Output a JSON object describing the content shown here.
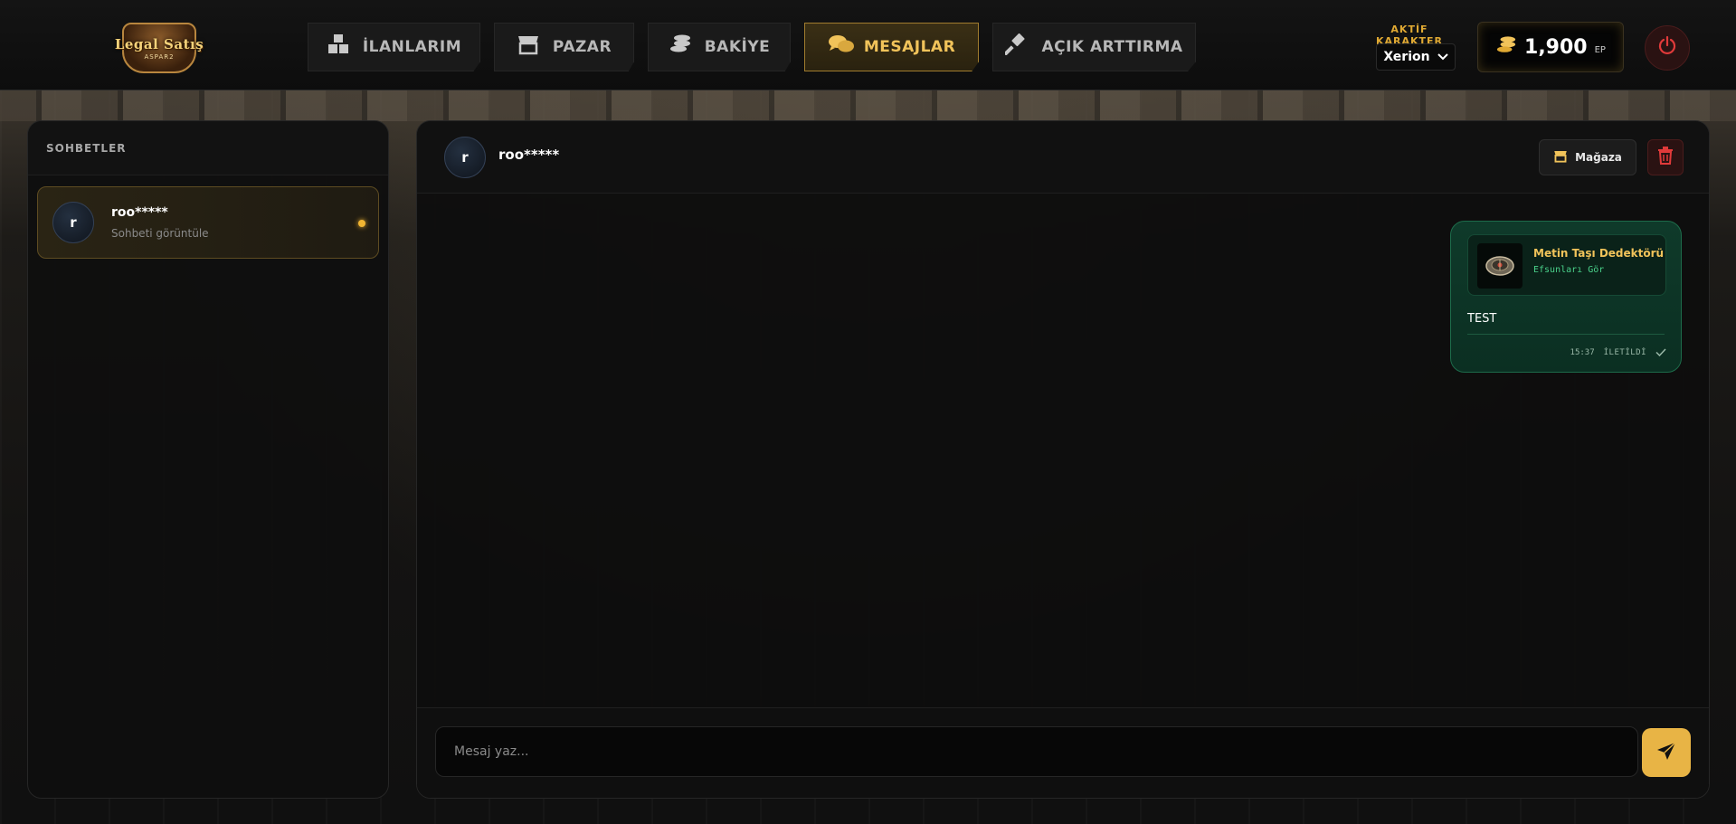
{
  "brand": {
    "logo_text": "Legal Satış",
    "logo_sub": "ASPAR2"
  },
  "nav": {
    "tabs": [
      {
        "label": "İLANLARIM",
        "icon": "boxes-icon"
      },
      {
        "label": "PAZAR",
        "icon": "store-icon"
      },
      {
        "label": "BAKİYE",
        "icon": "coins-icon"
      },
      {
        "label": "MESAJLAR",
        "icon": "chat-icon",
        "active": true
      },
      {
        "label": "AÇIK ARTTIRMA",
        "icon": "gavel-icon"
      }
    ]
  },
  "character": {
    "label": "AKTİF KARAKTER",
    "selected": "Xerion"
  },
  "balance": {
    "amount": "1,900",
    "unit": "EP"
  },
  "sidebar": {
    "title": "SOHBETLER",
    "conversations": [
      {
        "initial": "r",
        "name": "roo*****",
        "subtitle": "Sohbeti görüntüle",
        "unread": true
      }
    ]
  },
  "chat": {
    "partner": {
      "initial": "r",
      "name": "roo*****"
    },
    "store_label": "Mağaza",
    "messages": [
      {
        "item": {
          "title": "Metin Taşı Dedektörü",
          "link": "Efsunları Gör"
        },
        "text": "TEST",
        "time": "15:37",
        "status": "İLETİLDİ"
      }
    ],
    "composer": {
      "placeholder": "Mesaj yaz..."
    }
  },
  "colors": {
    "accent": "#f1c35a",
    "danger": "#e03a3a",
    "message_bg": "#0f3a2a"
  }
}
